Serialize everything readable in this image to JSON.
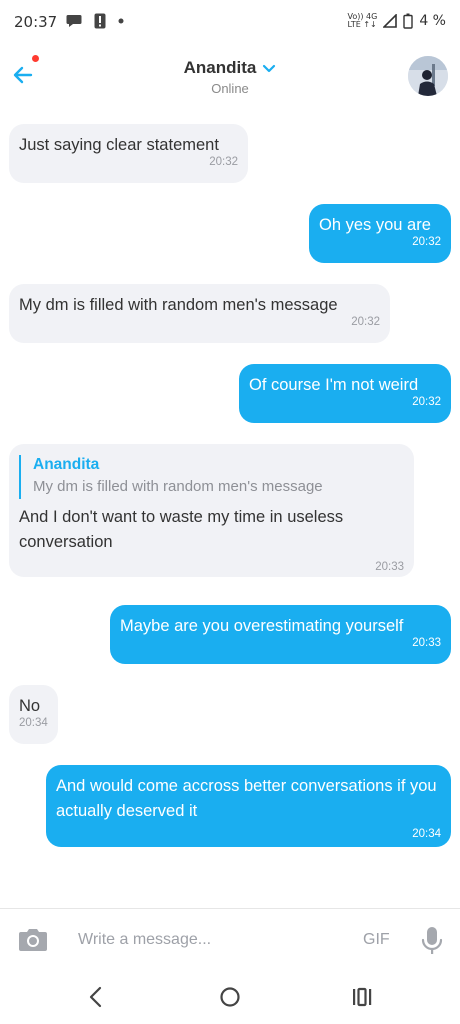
{
  "status_bar": {
    "time": "20:37",
    "network_top": "Vo)) 4G",
    "network_bottom": "LTE  ↑↓",
    "battery": "4 %"
  },
  "header": {
    "contact_name": "Anandita",
    "contact_status": "Online"
  },
  "messages": [
    {
      "direction": "incoming",
      "text": "Just saying clear statement",
      "time": "20:32"
    },
    {
      "direction": "outgoing",
      "text": "Oh yes you are",
      "time": "20:32"
    },
    {
      "direction": "incoming",
      "text": "My dm is filled with random men's message",
      "time": "20:32"
    },
    {
      "direction": "outgoing",
      "text": "Of course I'm not weird",
      "time": "20:32"
    },
    {
      "direction": "incoming",
      "reply_to": {
        "name": "Anandita",
        "text": "My dm is filled with random men's message"
      },
      "text": "And I don't want to waste my time in useless conversation",
      "time": "20:33"
    },
    {
      "direction": "outgoing",
      "text": "Maybe are you overestimating yourself",
      "time": "20:33"
    },
    {
      "direction": "incoming",
      "text": "No",
      "time": "20:34"
    },
    {
      "direction": "outgoing",
      "text": "And would come accross better conversations if you actually deserved it",
      "time": "20:34"
    }
  ],
  "composer": {
    "placeholder": "Write a message...",
    "gif_label": "GIF"
  },
  "colors": {
    "accent": "#1aaef0",
    "incoming_bubble": "#f1f2f6",
    "notification_dot": "#ff3b30"
  },
  "icons": [
    "back-arrow-icon",
    "chevron-down-icon",
    "camera-icon",
    "microphone-icon",
    "nav-back-icon",
    "nav-home-icon",
    "nav-recents-icon"
  ]
}
